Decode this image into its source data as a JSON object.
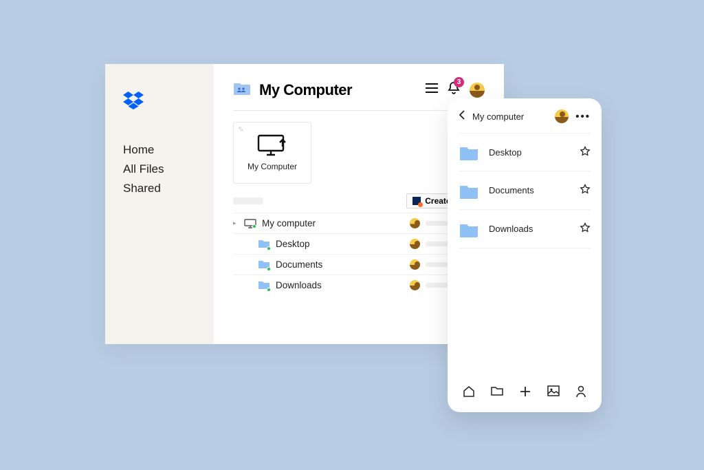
{
  "sidebar": {
    "items": [
      {
        "label": "Home"
      },
      {
        "label": "All Files"
      },
      {
        "label": "Shared"
      }
    ]
  },
  "header": {
    "title": "My Computer",
    "notification_count": "3"
  },
  "card": {
    "label": "My Computer"
  },
  "toolbar": {
    "create_label": "Create"
  },
  "tree": [
    {
      "name": "My computer",
      "type": "computer",
      "expandable": true
    },
    {
      "name": "Desktop",
      "type": "folder",
      "indent": true
    },
    {
      "name": "Documents",
      "type": "folder",
      "indent": true
    },
    {
      "name": "Downloads",
      "type": "folder",
      "indent": true
    }
  ],
  "mobile": {
    "title": "My computer",
    "items": [
      {
        "name": "Desktop"
      },
      {
        "name": "Documents"
      },
      {
        "name": "Downloads"
      }
    ]
  }
}
